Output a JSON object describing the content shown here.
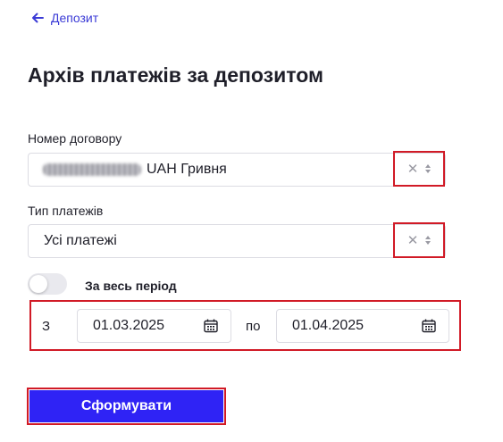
{
  "header": {
    "back_label": "Депозит",
    "back_icon": "arrow-left-icon",
    "title": "Архів платежів за депозитом"
  },
  "contract": {
    "label": "Номер договору",
    "value_masked": "blurred-account-number",
    "value": "UAH Гривня",
    "clear_icon": "close-icon",
    "sort_icon": "sort-arrows-icon"
  },
  "payment_type": {
    "label": "Тип платежів",
    "value": "Усі платежі",
    "clear_icon": "close-icon",
    "sort_icon": "sort-arrows-icon"
  },
  "whole_period": {
    "label": "За весь період",
    "enabled": false
  },
  "date_range": {
    "from_label": "З",
    "from_value": "01.03.2025",
    "to_label": "по",
    "to_value": "01.04.2025",
    "calendar_icon": "calendar-icon"
  },
  "submit": {
    "label": "Сформувати"
  },
  "colors": {
    "accent": "#2f23f5",
    "link": "#3b3bd6",
    "highlight_border": "#d11a26",
    "text": "#1f1f29"
  }
}
